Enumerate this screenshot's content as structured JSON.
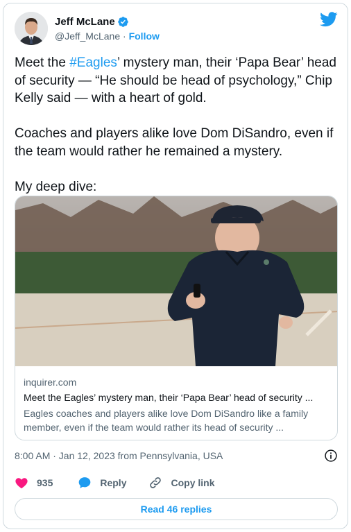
{
  "author": {
    "name": "Jeff McLane",
    "handle": "@Jeff_McLane",
    "separator": "·",
    "follow_label": "Follow"
  },
  "tweet": {
    "text_before_hashtag": "Meet the ",
    "hashtag": "#Eagles",
    "text_after_hashtag": "’ mystery man, their ‘Papa Bear’ head of security — “He should be head of psychology,” Chip Kelly said — with a heart of gold.\n\nCoaches and players alike love Dom DiSandro, even if the team would rather he remained a mystery.\n\nMy deep dive:"
  },
  "link_card": {
    "domain": "inquirer.com",
    "title": "Meet the Eagles’ mystery man, their ‘Papa Bear’ head of security ...",
    "description": "Eagles coaches and players alike love Dom DiSandro like a family member, even if the team would rather its head of security ..."
  },
  "meta": {
    "timestamp": "8:00 AM · Jan 12, 2023 from Pennsylvania, USA"
  },
  "actions": {
    "like_count": "935",
    "reply_label": "Reply",
    "copy_link_label": "Copy link"
  },
  "footer": {
    "read_replies_label": "Read 46 replies"
  },
  "colors": {
    "brand_blue": "#1d9bf0",
    "like_red": "#f91880",
    "secondary_text": "#536471",
    "border": "#cfd9de"
  },
  "icons": [
    "verified-badge-icon",
    "twitter-bird-icon",
    "info-icon",
    "heart-icon",
    "reply-bubble-icon",
    "link-icon"
  ]
}
